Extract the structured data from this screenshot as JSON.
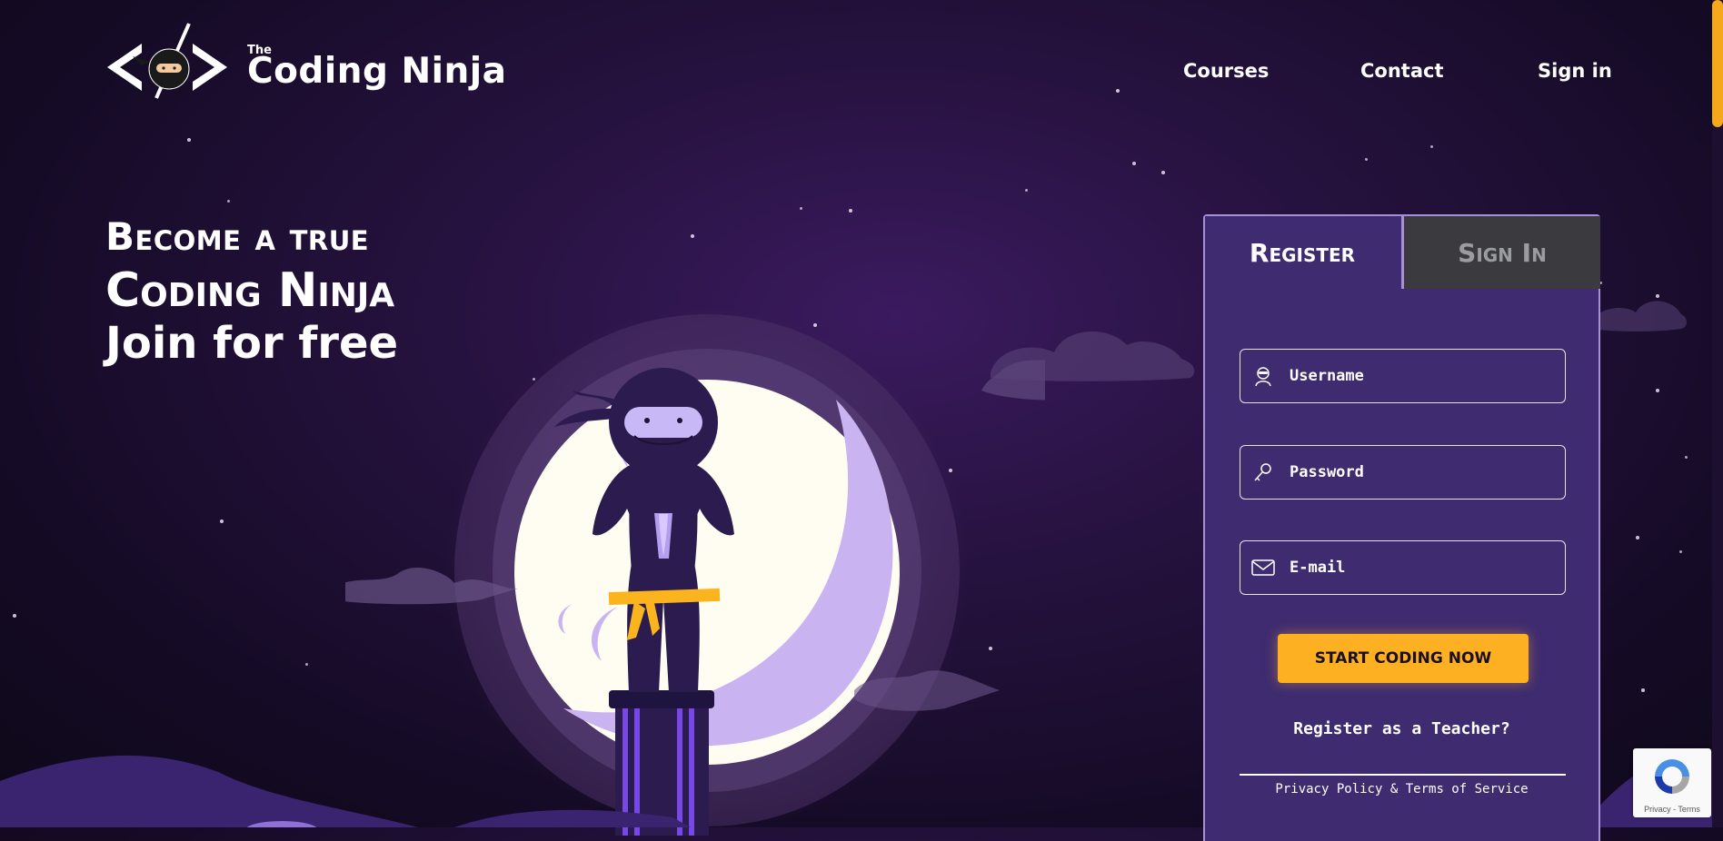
{
  "header": {
    "logo_the": "The",
    "logo_name": "Coding Ninja",
    "nav": [
      {
        "label": "Courses"
      },
      {
        "label": "Contact"
      },
      {
        "label": "Sign in"
      }
    ]
  },
  "hero": {
    "line1": "Become a true",
    "line2": "Coding Ninja",
    "line3": "Join for free"
  },
  "form": {
    "tabs": {
      "register": "Register",
      "signin": "Sign In"
    },
    "username_placeholder": "Username",
    "password_placeholder": "Password",
    "email_placeholder": "E-mail",
    "submit_label": "START CODING NOW",
    "teacher_link": "Register as a Teacher?",
    "privacy": "Privacy Policy",
    "amp": "&",
    "terms": "Terms of Service"
  },
  "recaptcha": {
    "links": "Privacy - Terms"
  },
  "colors": {
    "accent": "#fdb022",
    "panel": "#3e2b70",
    "background": "#1a0d2e"
  },
  "icons": [
    "ninja-logo-icon",
    "user-ninja-icon",
    "key-icon",
    "envelope-icon",
    "recaptcha-icon"
  ]
}
